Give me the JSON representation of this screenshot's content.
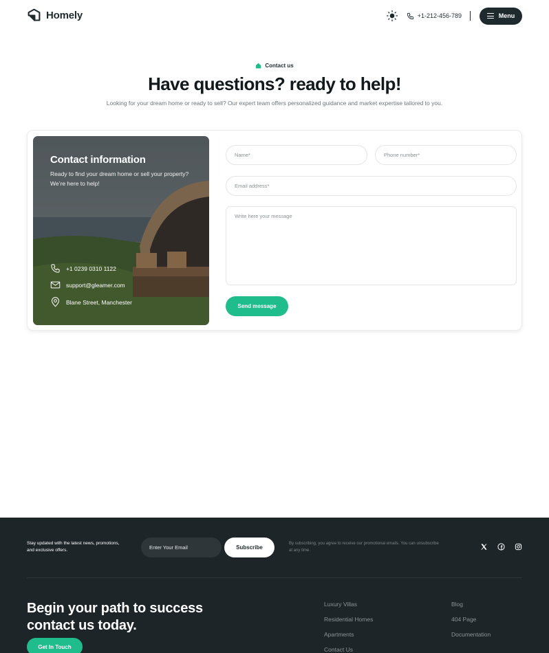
{
  "header": {
    "logo_text": "Homely",
    "phone": "+1-212-456-789",
    "menu_label": "Menu"
  },
  "hero": {
    "tag": "Contact us",
    "title": "Have questions? ready to help!",
    "subtitle": "Looking for your dream home or ready to sell? Our expert team offers personalized guidance and market expertise tailored to you."
  },
  "contact_info": {
    "title": "Contact information",
    "description": "Ready to find your dream home or sell your property? We’re here to help!",
    "phone": "+1 0239 0310 1122",
    "email": "support@gleamer.com",
    "address": "Blane Street, Manchester"
  },
  "form": {
    "name_placeholder": "Name*",
    "phone_placeholder": "Phone number*",
    "email_placeholder": "Email address*",
    "message_placeholder": "Write here your message",
    "submit_label": "Send message"
  },
  "footer": {
    "newsletter_text": "Stay updated with the latest news, promotions, and exclusive offers.",
    "email_placeholder": "Enter Your Email",
    "subscribe_label": "Subscribe",
    "disclaimer": "By subscribing, you agree to receive our promotional emails. You can unsubscribe at any time.",
    "socials": [
      "x-icon",
      "facebook-icon",
      "instagram-icon"
    ],
    "cta_title": "Begin your path to success contact us today.",
    "cta_button": "Get In Touch",
    "links_col1": [
      "Luxury Villas",
      "Residential Homes",
      "Apartments",
      "Contact Us"
    ],
    "links_col2": [
      "Blog",
      "404 Page",
      "Documentation"
    ]
  },
  "colors": {
    "accent": "#1fbd8c",
    "dark": "#1e2528",
    "text": "#1f2a2e"
  }
}
